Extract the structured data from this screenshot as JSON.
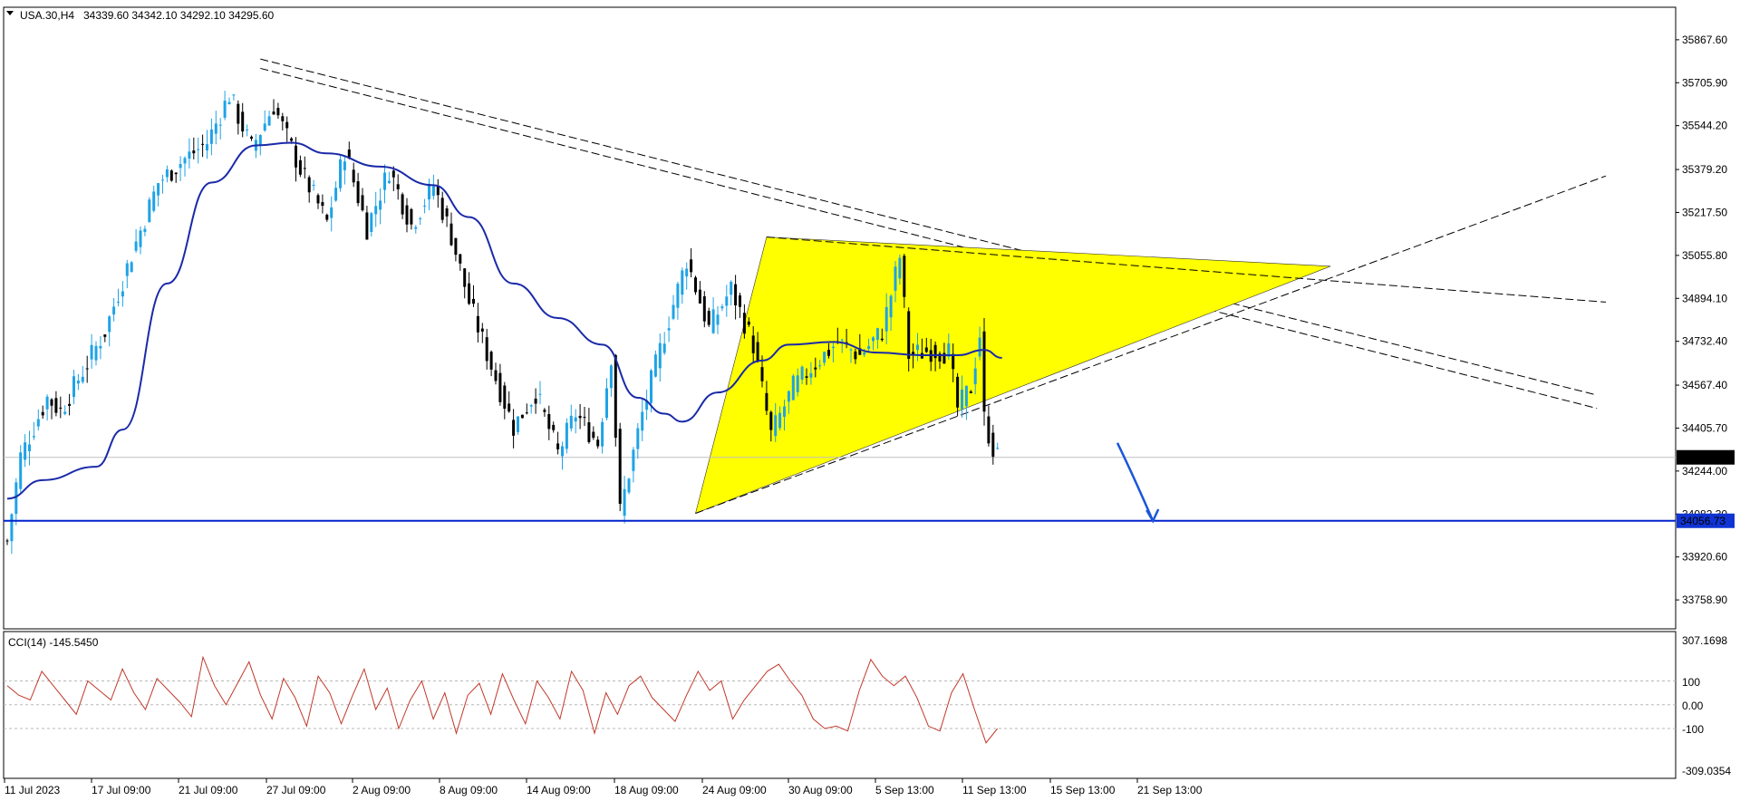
{
  "colors": {
    "bull": "#1fa3e6",
    "bear": "#000000",
    "ma": "#1a2aa8",
    "cci": "#c0392b",
    "triangle_fill": "#ffff00",
    "support": "#0022cc",
    "price_badge_bg": "#1034d4",
    "arrow": "#1a56d9"
  },
  "header": {
    "symbol": "USA.30,H4",
    "ohlc": "34339.60 34342.10 34292.10 34295.60",
    "collapse_icon": "triangle-down-icon"
  },
  "indicator": {
    "label": "CCI(14) -145.5450",
    "y_labels": [
      "307.1698",
      "100",
      "0.00",
      "-100",
      "-309.0354"
    ]
  },
  "chart_data": {
    "type": "candlestick",
    "title": "",
    "symbol": "USA.30",
    "timeframe": "H4",
    "ylim": [
      33650,
      35990
    ],
    "y_tick_labels": [
      "35867.60",
      "35705.90",
      "35544.20",
      "35379.20",
      "35217.50",
      "35055.80",
      "34894.10",
      "34732.40",
      "34567.40",
      "34405.70",
      "34244.00",
      "34082.30",
      "33920.60",
      "33758.90"
    ],
    "x_tick_labels": [
      "11 Jul 2023",
      "17 Jul 09:00",
      "21 Jul 09:00",
      "27 Jul 09:00",
      "2 Aug 09:00",
      "8 Aug 09:00",
      "14 Aug 09:00",
      "18 Aug 09:00",
      "24 Aug 09:00",
      "30 Aug 09:00",
      "5 Sep 13:00",
      "11 Sep 13:00",
      "15 Sep 13:00",
      "21 Sep 13:00"
    ],
    "current_price": "34295.60",
    "support_level": "34056.73",
    "price_trajectory": [
      {
        "bar": 0,
        "price": 33980
      },
      {
        "bar": 3,
        "price": 34300
      },
      {
        "bar": 9,
        "price": 34520
      },
      {
        "bar": 12,
        "price": 34470
      },
      {
        "bar": 17,
        "price": 34620
      },
      {
        "bar": 22,
        "price": 34770
      },
      {
        "bar": 28,
        "price": 35060
      },
      {
        "bar": 34,
        "price": 35330
      },
      {
        "bar": 40,
        "price": 35420
      },
      {
        "bar": 45,
        "price": 35480
      },
      {
        "bar": 50,
        "price": 35660
      },
      {
        "bar": 55,
        "price": 35460
      },
      {
        "bar": 60,
        "price": 35620
      },
      {
        "bar": 66,
        "price": 35380
      },
      {
        "bar": 72,
        "price": 35180
      },
      {
        "bar": 76,
        "price": 35450
      },
      {
        "bar": 81,
        "price": 35160
      },
      {
        "bar": 86,
        "price": 35380
      },
      {
        "bar": 91,
        "price": 35170
      },
      {
        "bar": 96,
        "price": 35320
      },
      {
        "bar": 100,
        "price": 35130
      },
      {
        "bar": 104,
        "price": 34880
      },
      {
        "bar": 109,
        "price": 34640
      },
      {
        "bar": 114,
        "price": 34410
      },
      {
        "bar": 119,
        "price": 34540
      },
      {
        "bar": 124,
        "price": 34310
      },
      {
        "bar": 128,
        "price": 34460
      },
      {
        "bar": 133,
        "price": 34350
      },
      {
        "bar": 136,
        "price": 34680
      },
      {
        "bar": 138,
        "price": 34090
      },
      {
        "bar": 143,
        "price": 34460
      },
      {
        "bar": 148,
        "price": 34760
      },
      {
        "bar": 153,
        "price": 35040
      },
      {
        "bar": 158,
        "price": 34780
      },
      {
        "bar": 163,
        "price": 34930
      },
      {
        "bar": 168,
        "price": 34720
      },
      {
        "bar": 172,
        "price": 34380
      },
      {
        "bar": 177,
        "price": 34560
      },
      {
        "bar": 182,
        "price": 34650
      },
      {
        "bar": 187,
        "price": 34730
      },
      {
        "bar": 192,
        "price": 34680
      },
      {
        "bar": 197,
        "price": 34770
      },
      {
        "bar": 201,
        "price": 35050
      },
      {
        "bar": 203,
        "price": 34680
      },
      {
        "bar": 208,
        "price": 34700
      },
      {
        "bar": 212,
        "price": 34690
      },
      {
        "bar": 214,
        "price": 34480
      },
      {
        "bar": 217,
        "price": 34560
      },
      {
        "bar": 219,
        "price": 34760
      },
      {
        "bar": 220,
        "price": 34440
      },
      {
        "bar": 222,
        "price": 34330
      },
      {
        "bar": 223,
        "price": 34296
      }
    ],
    "moving_average": [
      {
        "bar": 0,
        "price": 34140
      },
      {
        "bar": 8,
        "price": 34210
      },
      {
        "bar": 20,
        "price": 34260
      },
      {
        "bar": 26,
        "price": 34400
      },
      {
        "bar": 36,
        "price": 34950
      },
      {
        "bar": 46,
        "price": 35330
      },
      {
        "bar": 56,
        "price": 35470
      },
      {
        "bar": 64,
        "price": 35480
      },
      {
        "bar": 72,
        "price": 35440
      },
      {
        "bar": 84,
        "price": 35390
      },
      {
        "bar": 96,
        "price": 35320
      },
      {
        "bar": 104,
        "price": 35200
      },
      {
        "bar": 114,
        "price": 34950
      },
      {
        "bar": 124,
        "price": 34820
      },
      {
        "bar": 134,
        "price": 34720
      },
      {
        "bar": 142,
        "price": 34520
      },
      {
        "bar": 148,
        "price": 34460
      },
      {
        "bar": 152,
        "price": 34430
      },
      {
        "bar": 160,
        "price": 34540
      },
      {
        "bar": 170,
        "price": 34660
      },
      {
        "bar": 176,
        "price": 34720
      },
      {
        "bar": 186,
        "price": 34730
      },
      {
        "bar": 196,
        "price": 34690
      },
      {
        "bar": 206,
        "price": 34680
      },
      {
        "bar": 214,
        "price": 34680
      },
      {
        "bar": 220,
        "price": 34700
      },
      {
        "bar": 224,
        "price": 34670
      }
    ],
    "cci_values": [
      80,
      40,
      20,
      140,
      80,
      20,
      -40,
      100,
      60,
      20,
      150,
      50,
      -20,
      110,
      60,
      10,
      -50,
      200,
      80,
      0,
      90,
      180,
      40,
      -60,
      110,
      30,
      -90,
      120,
      50,
      -80,
      40,
      150,
      -20,
      70,
      -100,
      20,
      100,
      -60,
      50,
      -120,
      40,
      90,
      -40,
      130,
      20,
      -80,
      100,
      30,
      -60,
      140,
      60,
      -120,
      50,
      -40,
      80,
      120,
      30,
      -20,
      -70,
      40,
      140,
      60,
      100,
      -60,
      20,
      80,
      140,
      170,
      100,
      40,
      -60,
      -100,
      -90,
      -110,
      60,
      190,
      120,
      80,
      120,
      30,
      -90,
      -110,
      50,
      130,
      -20,
      -160,
      -100
    ],
    "drawings": [
      {
        "kind": "trendline-pair",
        "from": {
          "bar": 57,
          "price": 35795
        },
        "to": {
          "bar": 358,
          "price": 34530
        }
      },
      {
        "kind": "trendline-pair",
        "from": {
          "bar": 57,
          "price": 35760
        },
        "to": {
          "bar": 358,
          "price": 34480
        }
      },
      {
        "kind": "triangle",
        "points": [
          {
            "bar": 171,
            "price": 35125
          },
          {
            "bar": 298,
            "price": 35015
          },
          {
            "bar": 155,
            "price": 34085
          }
        ]
      },
      {
        "kind": "trendline",
        "from": {
          "bar": 155,
          "price": 34085
        },
        "to": {
          "bar": 360,
          "price": 35355
        }
      },
      {
        "kind": "trendline",
        "from": {
          "bar": 171,
          "price": 35125
        },
        "to": {
          "bar": 360,
          "price": 34880
        }
      },
      {
        "kind": "arrow",
        "from": {
          "bar": 250,
          "price": 34350
        },
        "to": {
          "bar": 258,
          "price": 34056
        }
      }
    ]
  }
}
